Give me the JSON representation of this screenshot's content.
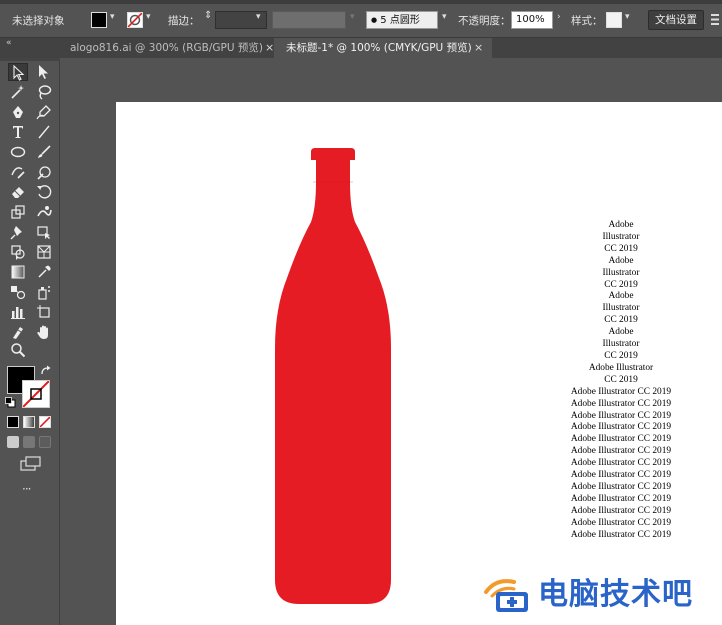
{
  "control_bar": {
    "selection_status": "未选择对象",
    "stroke_label": "描边：",
    "brush_value": "5 点圆形",
    "opacity_label": "不透明度：",
    "opacity_value": "100%",
    "style_label": "样式：",
    "doc_settings_button": "文档设置"
  },
  "tabs": [
    {
      "label": "alogo816.ai @ 300% (RGB/GPU 预览)",
      "active": false
    },
    {
      "label": "未标题-1* @ 100% (CMYK/GPU 预览)",
      "active": true
    }
  ],
  "tab_close_glyph": "×",
  "collapse_glyph": "«",
  "more_tools_glyph": "···",
  "canvas": {
    "bottle_color": "#e51c23",
    "text_lines": [
      "Adobe",
      "Illustrator",
      "CC 2019",
      "Adobe",
      "Illustrator",
      "CC 2019",
      "Adobe",
      "Illustrator",
      "CC 2019",
      "Adobe",
      "Illustrator",
      "CC 2019",
      "Adobe Illustrator",
      "CC 2019",
      "Adobe Illustrator CC 2019",
      "Adobe Illustrator CC 2019",
      "Adobe Illustrator CC 2019",
      "Adobe Illustrator CC 2019",
      "Adobe Illustrator CC 2019",
      "Adobe Illustrator CC 2019",
      "Adobe Illustrator CC 2019",
      "Adobe Illustrator CC 2019",
      "Adobe Illustrator CC 2019",
      "Adobe Illustrator CC 2019",
      "Adobe Illustrator CC 2019",
      "Adobe Illustrator CC 2019",
      "Adobe Illustrator CC 2019"
    ]
  },
  "watermark": {
    "text": "电脑技术吧",
    "color": "#2a64c8",
    "accent": "#f39a2b"
  },
  "colors": {
    "fill": "#000000",
    "stroke_none_slash": "#e21b1b"
  }
}
